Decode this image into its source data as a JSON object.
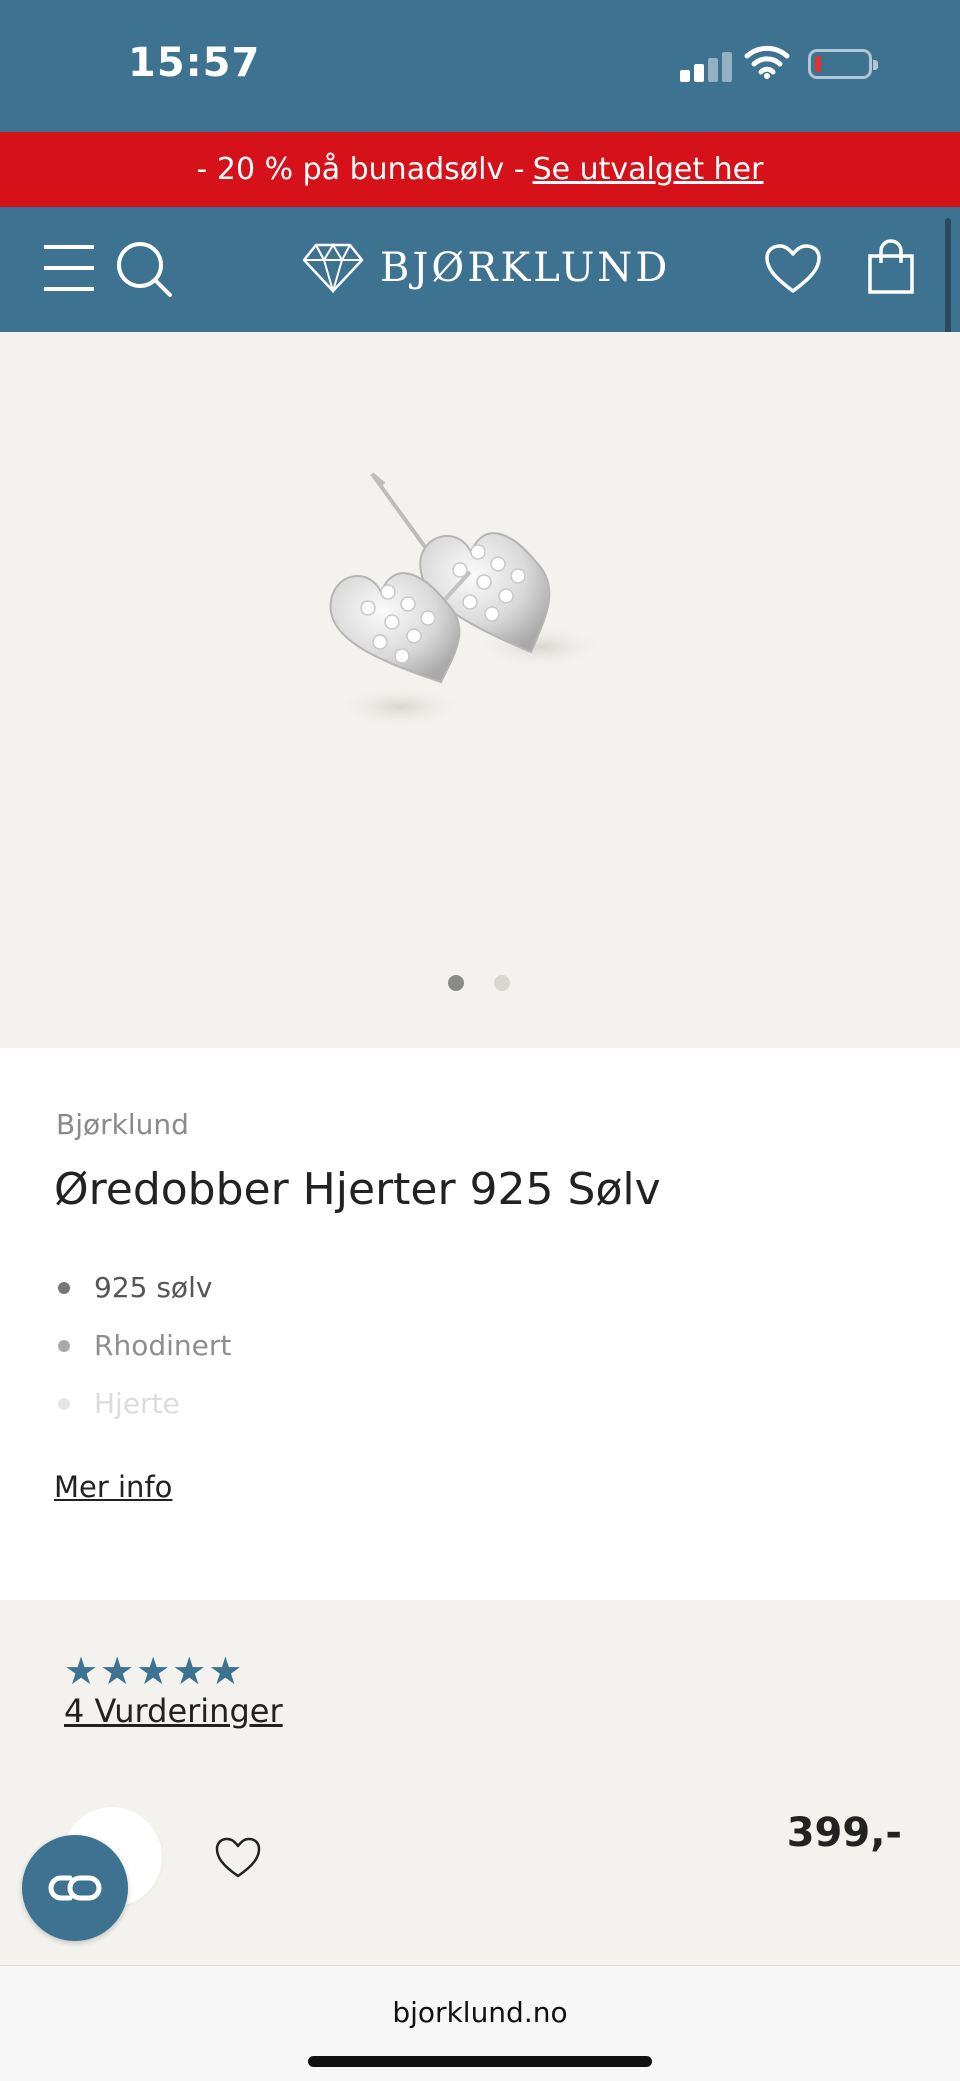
{
  "status_bar": {
    "time": "15:57"
  },
  "promo_banner": {
    "text": "- 20 % på bunadsølv -",
    "link": "Se utvalget her"
  },
  "header": {
    "logo_text": "BJØRKLUND",
    "icons": [
      "menu-icon",
      "search-icon",
      "diamond-logo-icon",
      "heart-icon",
      "shopping-bag-icon"
    ]
  },
  "gallery": {
    "image_count": 2,
    "active_index": 0
  },
  "product": {
    "brand": "Bjørklund",
    "title": "Øredobber Hjerter 925 Sølv",
    "features": [
      "925 sølv",
      "Rhodinert",
      "Hjerte"
    ],
    "more_info": "Mer info"
  },
  "rating": {
    "stars": 5,
    "reviews_label": "4 Vurderinger"
  },
  "purchase": {
    "price": "399,-"
  },
  "browser": {
    "url": "bjorklund.no"
  },
  "colors": {
    "header_blue": "#3d7291",
    "promo_red": "#d51219",
    "gallery_bg": "#f3f2ee"
  }
}
